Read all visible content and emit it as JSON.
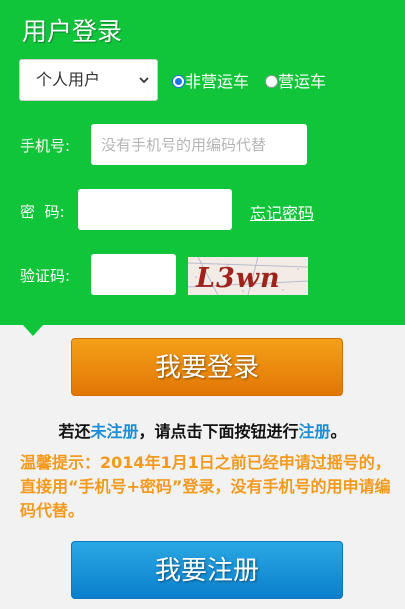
{
  "title": "用户登录",
  "user_type": {
    "selected": "个人用户"
  },
  "vehicle_type": {
    "options": [
      {
        "label": "非营运车",
        "checked": true
      },
      {
        "label": "营运车",
        "checked": false
      }
    ]
  },
  "phone": {
    "label": "手机号:",
    "placeholder": "没有手机号的用编码代替",
    "value": ""
  },
  "password": {
    "label": "密  码:",
    "value": "",
    "forgot_label": "忘记密码"
  },
  "captcha": {
    "label": "验证码:",
    "value": "",
    "image_text": "L3wn"
  },
  "login_button": "我要登录",
  "register_prompt": {
    "part1": "若还",
    "link1": "未注册",
    "part2": "，请点击下面按钮进行",
    "link2": "注册",
    "part3": "。"
  },
  "tip": "温馨提示：2014年1月1日之前已经申请过摇号的，直接用“手机号+密码”登录，没有手机号的用申请编码代替。",
  "register_button": "我要注册",
  "colors": {
    "panel": "#10c53a",
    "login_button": "#ee8a0e",
    "register_button": "#1796d9",
    "link": "#1a8fd6",
    "tip": "#f39a1e"
  },
  "icons": {
    "select_caret": "chevron-down-icon"
  }
}
